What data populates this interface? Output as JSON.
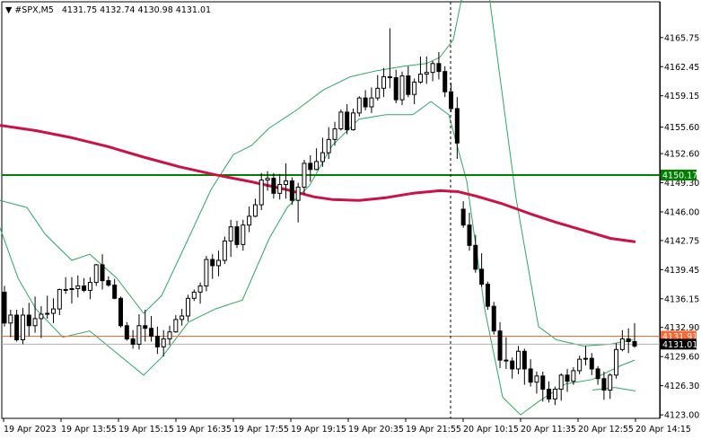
{
  "header": {
    "symbol": "#SPX,M5",
    "ohlc": "4131.75 4132.74 4130.98 4131.01"
  },
  "chart_data": {
    "type": "candlestick",
    "symbol": "#SPX",
    "timeframe": "M5",
    "ylim": [
      4122.6,
      4169.8
    ],
    "y_ticks": [
      "4165.75",
      "4162.45",
      "4159.15",
      "4155.60",
      "4152.60",
      "4149.30",
      "4146.00",
      "4142.75",
      "4139.45",
      "4136.15",
      "4132.90",
      "4129.60",
      "4126.30",
      "4123.00"
    ],
    "x_ticks": [
      "19 Apr 2023",
      "19 Apr 13:55",
      "19 Apr 15:15",
      "19 Apr 16:35",
      "19 Apr 17:55",
      "19 Apr 19:15",
      "19 Apr 20:35",
      "19 Apr 21:55",
      "20 Apr 10:15",
      "20 Apr 11:35",
      "20 Apr 12:55",
      "20 Apr 14:15"
    ],
    "horizontal_level": {
      "value": 4150.17,
      "label": "4150.17",
      "color": "#008000"
    },
    "bid_line": {
      "value": 4131.91,
      "label": "4131.91",
      "color": "#ff6633"
    },
    "current_price": {
      "value": 4131.01,
      "label": "4131.01"
    },
    "session_separator_label": "19 Apr 21:55",
    "moving_average": {
      "color": "#cc1144",
      "points": [
        [
          0,
          4155.8
        ],
        [
          40,
          4155.2
        ],
        [
          80,
          4154.4
        ],
        [
          120,
          4153.4
        ],
        [
          160,
          4152.2
        ],
        [
          200,
          4151.1
        ],
        [
          240,
          4150.2
        ],
        [
          280,
          4149.4
        ],
        [
          320,
          4148.5
        ],
        [
          350,
          4147.7
        ],
        [
          370,
          4147.4
        ],
        [
          400,
          4147.3
        ],
        [
          430,
          4147.6
        ],
        [
          460,
          4148.1
        ],
        [
          490,
          4148.4
        ],
        [
          510,
          4148.3
        ],
        [
          530,
          4147.8
        ],
        [
          560,
          4146.9
        ],
        [
          590,
          4145.8
        ],
        [
          620,
          4144.8
        ],
        [
          650,
          4143.9
        ],
        [
          680,
          4143.0
        ],
        [
          708,
          4142.6
        ]
      ]
    },
    "bands": {
      "color": "#2ca860",
      "upper": [
        [
          0,
          4147.3
        ],
        [
          30,
          4146.5
        ],
        [
          50,
          4143.5
        ],
        [
          80,
          4140.5
        ],
        [
          100,
          4141.2
        ],
        [
          130,
          4138.5
        ],
        [
          160,
          4134.5
        ],
        [
          180,
          4136.5
        ],
        [
          210,
          4143.0
        ],
        [
          235,
          4148.5
        ],
        [
          260,
          4152.5
        ],
        [
          280,
          4153.5
        ],
        [
          300,
          4155.5
        ],
        [
          330,
          4157.5
        ],
        [
          360,
          4159.8
        ],
        [
          390,
          4161.3
        ],
        [
          420,
          4162.0
        ],
        [
          450,
          4162.5
        ],
        [
          475,
          4162.8
        ],
        [
          490,
          4163.5
        ],
        [
          505,
          4165.5
        ],
        [
          515,
          4170.5
        ],
        [
          545,
          4170.5
        ],
        [
          575,
          4147.5
        ],
        [
          600,
          4133.0
        ],
        [
          620,
          4131.5
        ],
        [
          650,
          4130.8
        ],
        [
          680,
          4131.0
        ],
        [
          705,
          4131.5
        ]
      ],
      "lower": [
        [
          0,
          4144.2
        ],
        [
          20,
          4138.5
        ],
        [
          40,
          4135.0
        ],
        [
          70,
          4131.8
        ],
        [
          100,
          4132.5
        ],
        [
          130,
          4130.0
        ],
        [
          160,
          4127.5
        ],
        [
          180,
          4129.5
        ],
        [
          210,
          4133.5
        ],
        [
          240,
          4135.0
        ],
        [
          270,
          4136.0
        ],
        [
          300,
          4143.0
        ],
        [
          320,
          4146.5
        ],
        [
          345,
          4149.0
        ],
        [
          370,
          4153.5
        ],
        [
          400,
          4156.5
        ],
        [
          430,
          4157.0
        ],
        [
          460,
          4157.0
        ],
        [
          480,
          4158.5
        ],
        [
          500,
          4157.0
        ],
        [
          520,
          4149.5
        ],
        [
          540,
          4135.0
        ],
        [
          560,
          4125.0
        ],
        [
          580,
          4123.0
        ],
        [
          600,
          4124.5
        ],
        [
          630,
          4126.5
        ],
        [
          660,
          4127.0
        ],
        [
          690,
          4128.5
        ],
        [
          707,
          4129.2
        ]
      ],
      "middle": [
        [
          660,
          4125.8
        ],
        [
          685,
          4126.1
        ],
        [
          708,
          4125.7
        ]
      ]
    },
    "candles": [
      [
        4136.9,
        4137.6,
        4133.0,
        4133.4
      ],
      [
        4133.4,
        4134.9,
        4131.8,
        4134.3
      ],
      [
        4134.3,
        4134.9,
        4131.3,
        4131.5
      ],
      [
        4131.5,
        4135.1,
        4131.0,
        4134.3
      ],
      [
        4134.3,
        4135.7,
        4131.9,
        4133.1
      ],
      [
        4133.1,
        4136.4,
        4132.3,
        4133.9
      ],
      [
        4133.9,
        4135.3,
        4131.7,
        4134.4
      ],
      [
        4134.4,
        4136.5,
        4133.9,
        4134.5
      ],
      [
        4134.5,
        4136.2,
        4133.4,
        4135.0
      ],
      [
        4135.0,
        4137.3,
        4134.3,
        4137.2
      ],
      [
        4137.2,
        4138.6,
        4136.7,
        4137.2
      ],
      [
        4137.2,
        4138.6,
        4135.6,
        4137.3
      ],
      [
        4137.3,
        4138.8,
        4136.3,
        4137.6
      ],
      [
        4137.6,
        4138.5,
        4136.9,
        4137.1
      ],
      [
        4137.1,
        4138.6,
        4136.1,
        4138.0
      ],
      [
        4138.0,
        4140.1,
        4137.6,
        4140.0
      ],
      [
        4140.0,
        4141.2,
        4137.2,
        4138.2
      ],
      [
        4138.2,
        4138.7,
        4137.5,
        4137.7
      ],
      [
        4137.7,
        4138.4,
        4136.1,
        4136.2
      ],
      [
        4136.2,
        4136.4,
        4132.9,
        4133.1
      ],
      [
        4133.1,
        4133.5,
        4131.4,
        4131.6
      ],
      [
        4131.6,
        4132.6,
        4130.5,
        4131.0
      ],
      [
        4131.0,
        4134.4,
        4130.4,
        4133.1
      ],
      [
        4133.1,
        4134.9,
        4131.3,
        4132.8
      ],
      [
        4132.8,
        4134.2,
        4131.3,
        4131.9
      ],
      [
        4131.9,
        4133.0,
        4129.9,
        4130.7
      ],
      [
        4130.7,
        4132.6,
        4129.6,
        4131.6
      ],
      [
        4131.6,
        4133.1,
        4130.9,
        4132.4
      ],
      [
        4132.4,
        4134.3,
        4132.3,
        4133.8
      ],
      [
        4133.8,
        4135.0,
        4133.1,
        4134.2
      ],
      [
        4134.2,
        4136.6,
        4133.6,
        4136.2
      ],
      [
        4136.2,
        4137.2,
        4135.9,
        4136.9
      ],
      [
        4136.9,
        4138.0,
        4135.6,
        4137.6
      ],
      [
        4137.6,
        4141.0,
        4137.0,
        4140.6
      ],
      [
        4140.6,
        4141.2,
        4138.4,
        4139.9
      ],
      [
        4139.9,
        4141.6,
        4138.7,
        4140.5
      ],
      [
        4140.5,
        4143.2,
        4140.1,
        4142.7
      ],
      [
        4142.7,
        4145.1,
        4140.9,
        4144.3
      ],
      [
        4144.3,
        4145.0,
        4141.9,
        4142.3
      ],
      [
        4142.3,
        4145.1,
        4141.6,
        4144.5
      ],
      [
        4144.5,
        4146.6,
        4143.7,
        4145.5
      ],
      [
        4145.5,
        4147.5,
        4145.4,
        4146.8
      ],
      [
        4146.8,
        4150.4,
        4146.2,
        4149.6
      ],
      [
        4149.6,
        4150.6,
        4148.4,
        4149.8
      ],
      [
        4149.8,
        4150.4,
        4147.5,
        4148.1
      ],
      [
        4148.1,
        4150.3,
        4147.4,
        4149.1
      ],
      [
        4149.1,
        4151.5,
        4147.5,
        4149.5
      ],
      [
        4149.5,
        4149.9,
        4146.8,
        4147.3
      ],
      [
        4147.3,
        4149.3,
        4144.8,
        4148.8
      ],
      [
        4148.8,
        4151.9,
        4148.0,
        4151.5
      ],
      [
        4151.5,
        4152.4,
        4149.4,
        4150.8
      ],
      [
        4150.8,
        4153.2,
        4150.7,
        4151.7
      ],
      [
        4151.7,
        4154.4,
        4151.1,
        4152.7
      ],
      [
        4152.7,
        4155.6,
        4152.0,
        4154.2
      ],
      [
        4154.2,
        4156.2,
        4153.5,
        4155.4
      ],
      [
        4155.4,
        4157.6,
        4155.2,
        4157.3
      ],
      [
        4157.3,
        4158.2,
        4154.8,
        4155.3
      ],
      [
        4155.3,
        4157.7,
        4155.2,
        4157.2
      ],
      [
        4157.2,
        4159.1,
        4156.8,
        4158.9
      ],
      [
        4158.9,
        4159.8,
        4157.5,
        4157.9
      ],
      [
        4157.9,
        4160.1,
        4157.2,
        4158.9
      ],
      [
        4158.9,
        4161.5,
        4158.6,
        4160.0
      ],
      [
        4160.0,
        4162.3,
        4159.0,
        4161.3
      ],
      [
        4161.3,
        4166.8,
        4160.0,
        4161.2
      ],
      [
        4161.2,
        4162.1,
        4158.3,
        4158.7
      ],
      [
        4158.7,
        4161.9,
        4158.1,
        4161.4
      ],
      [
        4161.4,
        4162.5,
        4159.0,
        4159.3
      ],
      [
        4159.3,
        4161.1,
        4158.2,
        4160.7
      ],
      [
        4160.7,
        4163.6,
        4160.5,
        4161.6
      ],
      [
        4161.6,
        4163.6,
        4160.5,
        4161.8
      ],
      [
        4161.8,
        4163.1,
        4160.8,
        4162.8
      ],
      [
        4162.8,
        4164.1,
        4161.0,
        4161.9
      ],
      [
        4161.9,
        4162.5,
        4159.0,
        4159.6
      ],
      [
        4159.6,
        4160.6,
        4157.3,
        4157.7
      ],
      [
        4157.7,
        4159.0,
        4152.0,
        4153.8
      ],
      [
        4146.3,
        4147.2,
        4144.2,
        4144.5
      ],
      [
        4144.5,
        4145.9,
        4141.6,
        4142.2
      ],
      [
        4142.2,
        4143.4,
        4139.1,
        4139.5
      ],
      [
        4139.5,
        4141.3,
        4137.5,
        4137.8
      ],
      [
        4137.8,
        4138.1,
        4134.9,
        4135.3
      ],
      [
        4135.3,
        4135.8,
        4132.1,
        4132.5
      ],
      [
        4132.5,
        4133.5,
        4128.3,
        4129.2
      ],
      [
        4129.2,
        4131.8,
        4128.2,
        4129.1
      ],
      [
        4129.1,
        4129.5,
        4127.1,
        4128.2
      ],
      [
        4128.2,
        4130.8,
        4127.6,
        4130.2
      ],
      [
        4130.2,
        4130.5,
        4126.4,
        4128.2
      ],
      [
        4128.2,
        4129.3,
        4126.2,
        4126.7
      ],
      [
        4126.7,
        4127.9,
        4125.4,
        4127.4
      ],
      [
        4127.4,
        4127.9,
        4124.5,
        4125.9
      ],
      [
        4125.9,
        4126.8,
        4124.4,
        4124.8
      ],
      [
        4124.8,
        4126.2,
        4124.1,
        4125.9
      ],
      [
        4125.9,
        4127.7,
        4124.6,
        4127.5
      ],
      [
        4127.5,
        4128.2,
        4125.6,
        4126.8
      ],
      [
        4126.8,
        4128.4,
        4126.4,
        4128.0
      ],
      [
        4128.0,
        4129.7,
        4127.6,
        4129.3
      ],
      [
        4129.3,
        4130.8,
        4128.6,
        4129.4
      ],
      [
        4129.4,
        4130.0,
        4127.5,
        4128.2
      ],
      [
        4128.2,
        4128.5,
        4126.4,
        4127.1
      ],
      [
        4127.1,
        4127.9,
        4124.7,
        4125.8
      ],
      [
        4125.8,
        4127.7,
        4124.8,
        4127.5
      ],
      [
        4127.5,
        4131.1,
        4127.1,
        4130.4
      ],
      [
        4130.4,
        4132.6,
        4130.2,
        4131.6
      ],
      [
        4131.6,
        4132.8,
        4130.0,
        4131.3
      ],
      [
        4131.3,
        4133.4,
        4130.6,
        4130.8
      ]
    ]
  }
}
